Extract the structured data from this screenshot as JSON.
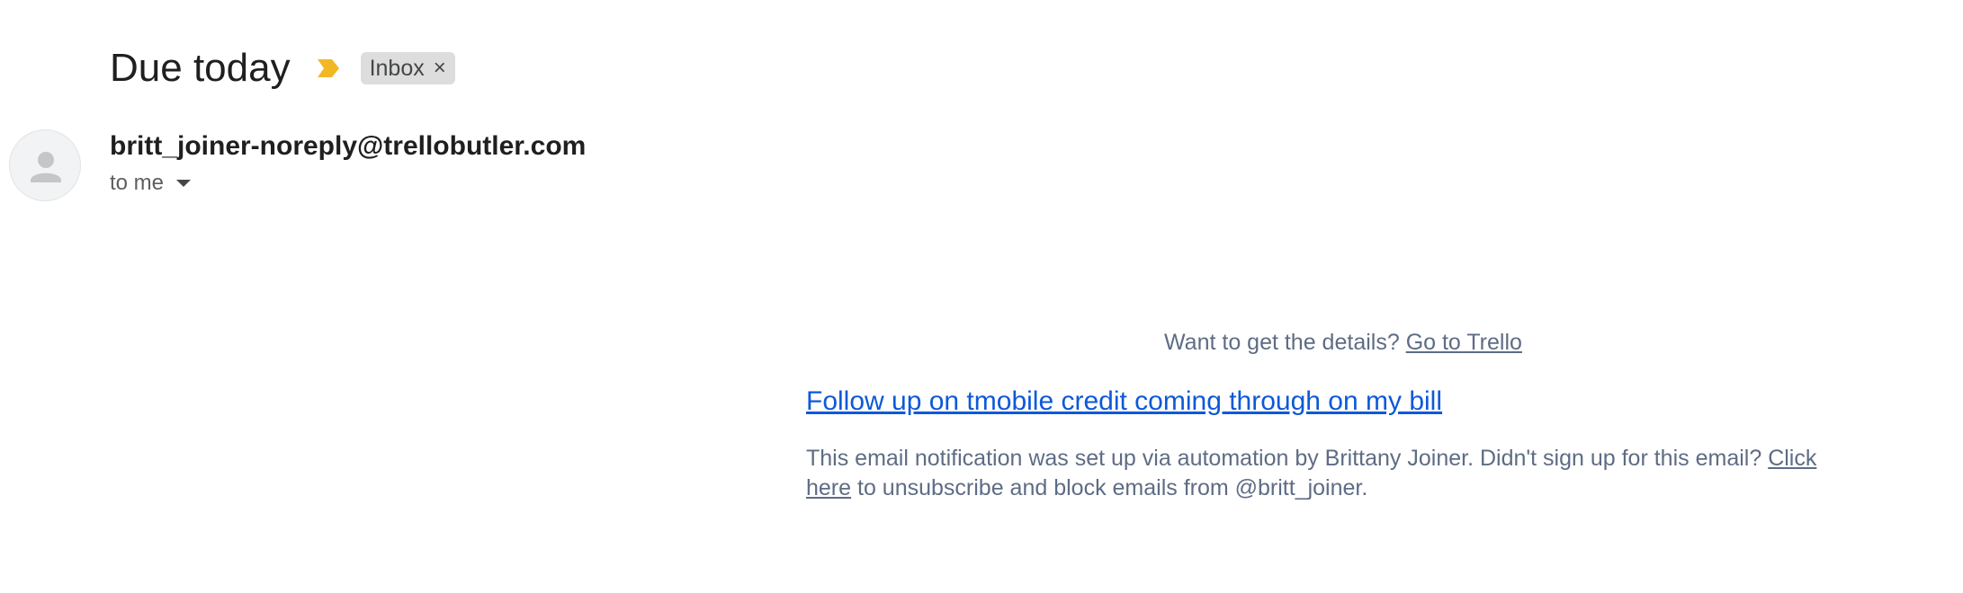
{
  "email": {
    "subject": "Due today",
    "label": "Inbox",
    "label_remove": "×",
    "sender": "britt_joiner-noreply@trellobutler.com",
    "recipient": "to me"
  },
  "body": {
    "details_prompt": "Want to get the details?",
    "details_link": "Go to Trello",
    "card_link": "Follow up on tmobile credit coming through on my bill",
    "footer_prefix": "This email notification was set up via automation by Brittany Joiner. Didn't sign up for this email?",
    "footer_link": "Click here",
    "footer_suffix": "to unsubscribe and block emails from @britt_joiner."
  },
  "colors": {
    "importance_marker": "#f2b824",
    "link": "#0c59d8",
    "muted_text": "#5e6c84",
    "label_chip_bg": "#dddddd"
  },
  "icons": {
    "importance": "importance-marker-icon",
    "avatar": "default-avatar-icon",
    "recipient_details": "caret-down-icon",
    "label_remove": "close-icon"
  }
}
